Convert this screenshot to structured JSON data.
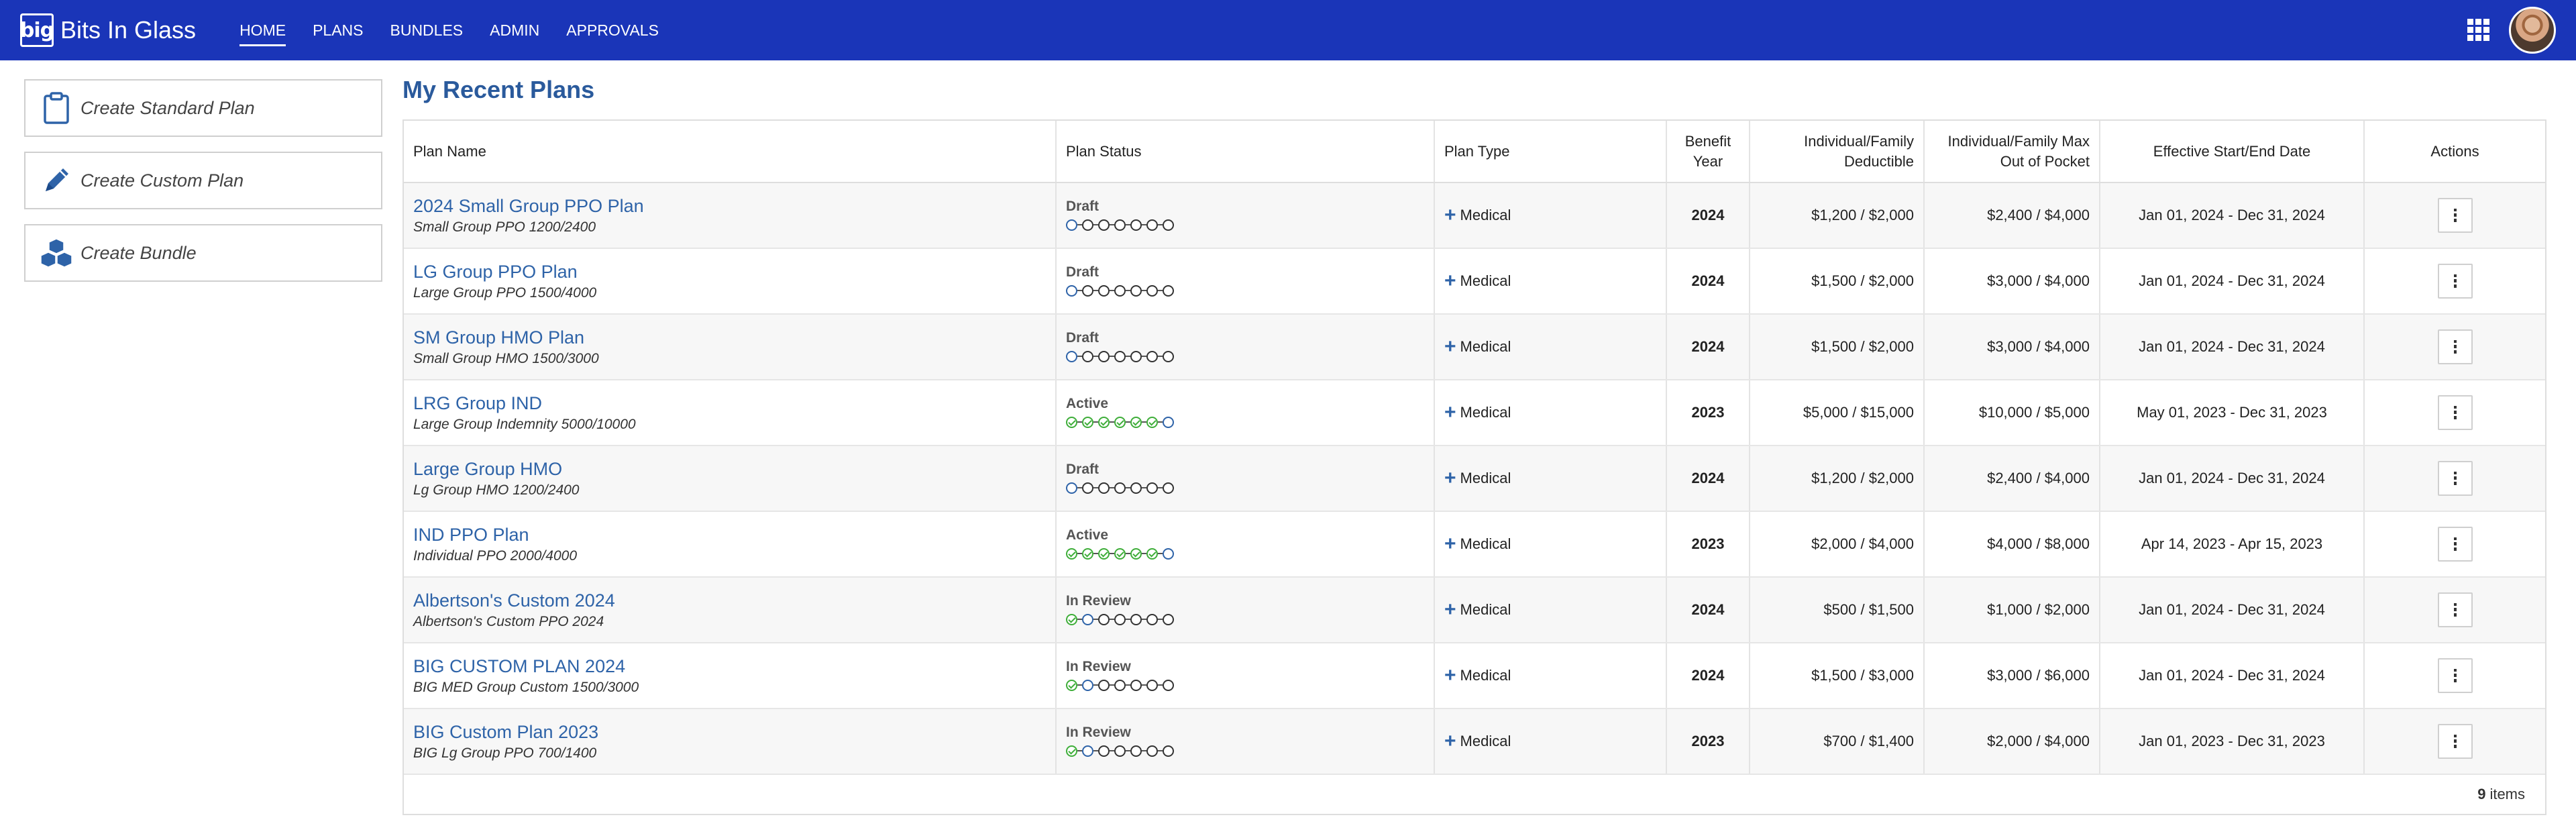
{
  "app": {
    "logo_text": "big",
    "brand_name": "Bits In Glass",
    "nav": [
      {
        "label": "HOME",
        "active": true
      },
      {
        "label": "PLANS",
        "active": false
      },
      {
        "label": "BUNDLES",
        "active": false
      },
      {
        "label": "ADMIN",
        "active": false
      },
      {
        "label": "APPROVALS",
        "active": false
      }
    ],
    "right_icons": [
      "apps-grid-icon",
      "user-avatar"
    ]
  },
  "sidebar": {
    "buttons": [
      {
        "label": "Create Standard Plan",
        "icon": "clipboard-icon"
      },
      {
        "label": "Create Custom Plan",
        "icon": "pencil-icon"
      },
      {
        "label": "Create Bundle",
        "icon": "cubes-icon"
      }
    ]
  },
  "main": {
    "title": "My Recent Plans",
    "columns": {
      "plan_name": "Plan Name",
      "plan_status": "Plan Status",
      "plan_type": "Plan Type",
      "benefit_year": "Benefit Year",
      "deductible": "Individual/Family Deductible",
      "max_oop": "Individual/Family Max Out of Pocket",
      "effective": "Effective Start/End Date",
      "actions": "Actions"
    },
    "rows": [
      {
        "name": "2024 Small Group PPO Plan",
        "sub": "Small Group PPO 1200/2400",
        "status": "Draft",
        "steps": [
          "current",
          "todo",
          "todo",
          "todo",
          "todo",
          "todo",
          "todo"
        ],
        "type": "Medical",
        "year": "2024",
        "deductible": "$1,200 / $2,000",
        "max_oop": "$2,400 / $4,000",
        "effective": "Jan 01, 2024 - Dec 31, 2024"
      },
      {
        "name": "LG Group PPO Plan",
        "sub": "Large Group PPO 1500/4000",
        "status": "Draft",
        "steps": [
          "current",
          "todo",
          "todo",
          "todo",
          "todo",
          "todo",
          "todo"
        ],
        "type": "Medical",
        "year": "2024",
        "deductible": "$1,500 / $2,000",
        "max_oop": "$3,000 / $4,000",
        "effective": "Jan 01, 2024 - Dec 31, 2024"
      },
      {
        "name": "SM Group HMO Plan",
        "sub": "Small Group HMO 1500/3000",
        "status": "Draft",
        "steps": [
          "current",
          "todo",
          "todo",
          "todo",
          "todo",
          "todo",
          "todo"
        ],
        "type": "Medical",
        "year": "2024",
        "deductible": "$1,500 / $2,000",
        "max_oop": "$3,000 / $4,000",
        "effective": "Jan 01, 2024 - Dec 31, 2024"
      },
      {
        "name": "LRG Group IND",
        "sub": "Large Group Indemnity 5000/10000",
        "status": "Active",
        "steps": [
          "done",
          "done",
          "done",
          "done",
          "done",
          "done",
          "current"
        ],
        "type": "Medical",
        "year": "2023",
        "deductible": "$5,000 / $15,000",
        "max_oop": "$10,000 / $5,000",
        "effective": "May 01, 2023 - Dec 31, 2023"
      },
      {
        "name": "Large Group HMO",
        "sub": "Lg Group HMO 1200/2400",
        "status": "Draft",
        "steps": [
          "current",
          "todo",
          "todo",
          "todo",
          "todo",
          "todo",
          "todo"
        ],
        "type": "Medical",
        "year": "2024",
        "deductible": "$1,200 / $2,000",
        "max_oop": "$2,400 / $4,000",
        "effective": "Jan 01, 2024 - Dec 31, 2024"
      },
      {
        "name": "IND PPO Plan",
        "sub": "Individual PPO 2000/4000",
        "status": "Active",
        "steps": [
          "done",
          "done",
          "done",
          "done",
          "done",
          "done",
          "current"
        ],
        "type": "Medical",
        "year": "2023",
        "deductible": "$2,000 / $4,000",
        "max_oop": "$4,000 / $8,000",
        "effective": "Apr 14, 2023 - Apr 15, 2023"
      },
      {
        "name": "Albertson's Custom 2024",
        "sub": "Albertson's Custom PPO 2024",
        "status": "In Review",
        "steps": [
          "done",
          "current",
          "todo",
          "todo",
          "todo",
          "todo",
          "todo"
        ],
        "type": "Medical",
        "year": "2024",
        "deductible": "$500 / $1,500",
        "max_oop": "$1,000 / $2,000",
        "effective": "Jan 01, 2024 - Dec 31, 2024"
      },
      {
        "name": "BIG CUSTOM PLAN 2024",
        "sub": "BIG MED Group Custom 1500/3000",
        "status": "In Review",
        "steps": [
          "done",
          "current",
          "todo",
          "todo",
          "todo",
          "todo",
          "todo"
        ],
        "type": "Medical",
        "year": "2024",
        "deductible": "$1,500 / $3,000",
        "max_oop": "$3,000 / $6,000",
        "effective": "Jan 01, 2024 - Dec 31, 2024"
      },
      {
        "name": "BIG Custom Plan 2023",
        "sub": "BIG Lg Group PPO 700/1400",
        "status": "In Review",
        "steps": [
          "done",
          "current",
          "todo",
          "todo",
          "todo",
          "todo",
          "todo"
        ],
        "type": "Medical",
        "year": "2023",
        "deductible": "$700 / $1,400",
        "max_oop": "$2,000 / $4,000",
        "effective": "Jan 01, 2023 - Dec 31, 2023"
      }
    ],
    "footer": {
      "count": "9",
      "label": "items"
    }
  },
  "colors": {
    "topbar": "#1a35b8",
    "link": "#2e63a8",
    "step_done": "#3fae3a"
  }
}
